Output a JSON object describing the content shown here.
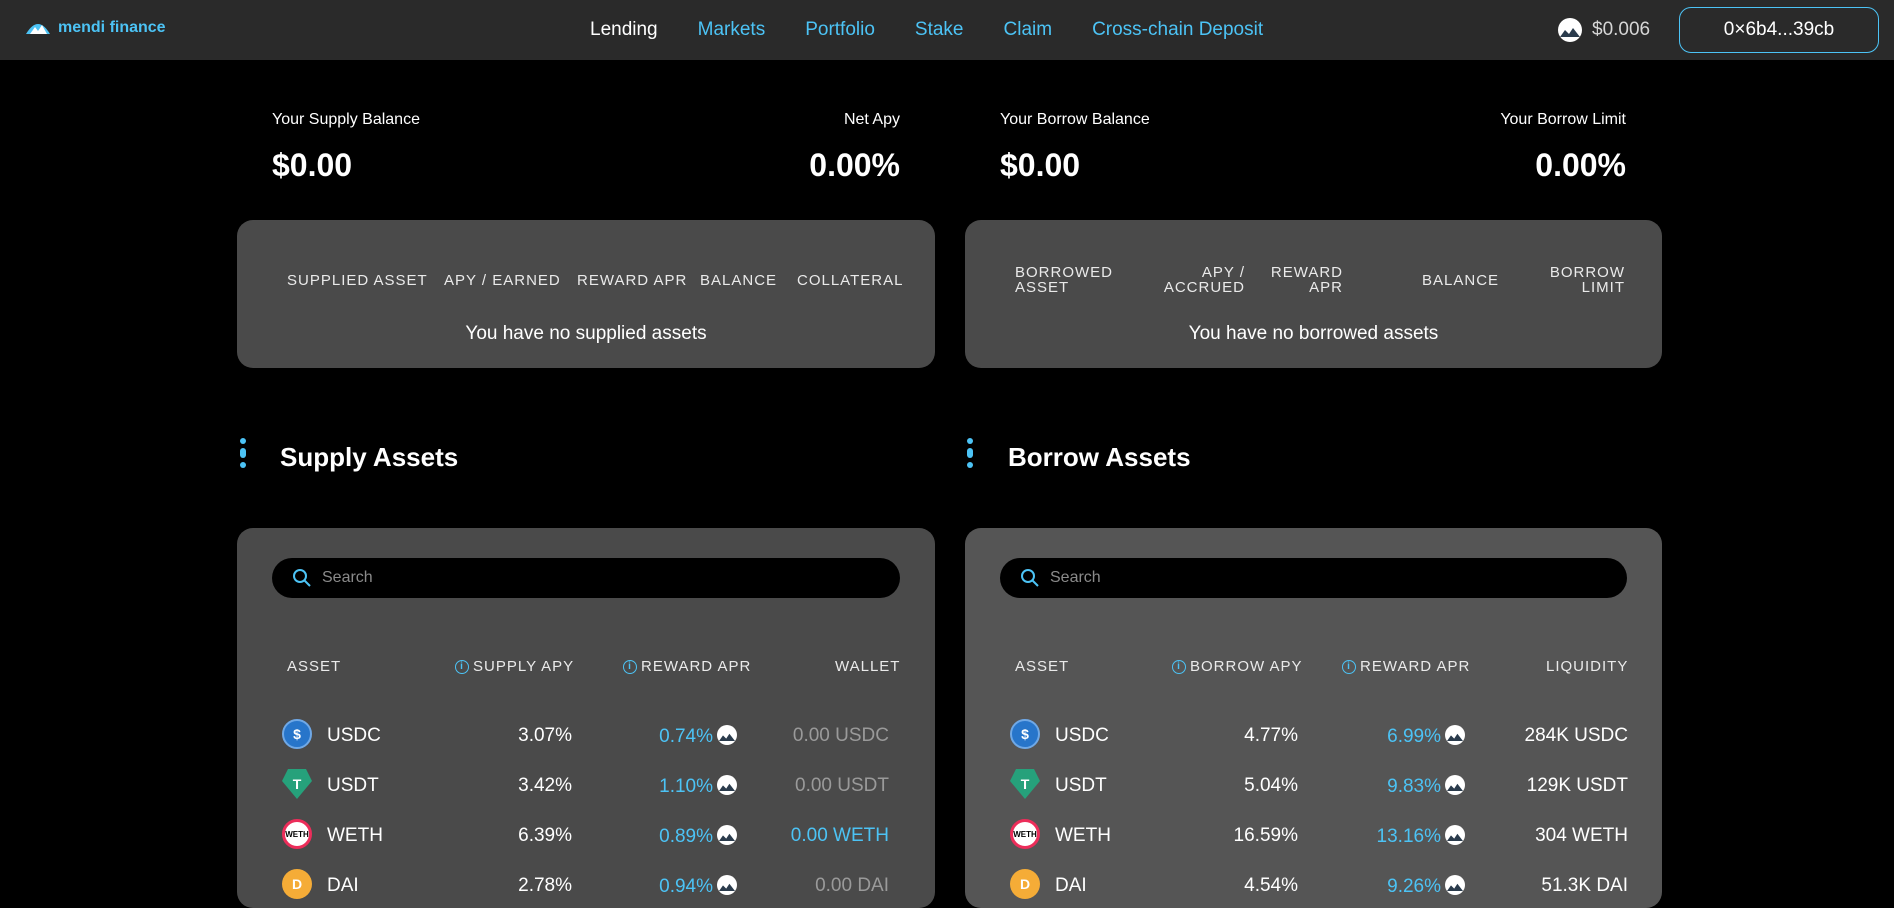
{
  "brand": {
    "name": "mendi finance"
  },
  "nav": [
    "Lending",
    "Markets",
    "Portfolio",
    "Stake",
    "Claim",
    "Cross-chain Deposit"
  ],
  "price": "$0.006",
  "wallet": "0×6b4...39cb",
  "summary": {
    "supply_balance_label": "Your Supply Balance",
    "supply_balance": "$0.00",
    "net_apy_label": "Net Apy",
    "net_apy": "0.00%",
    "borrow_balance_label": "Your Borrow Balance",
    "borrow_balance": "$0.00",
    "borrow_limit_label": "Your Borrow Limit",
    "borrow_limit": "0.00%"
  },
  "supplied": {
    "headers": [
      "SUPPLIED ASSET",
      "APY / EARNED",
      "REWARD APR",
      "BALANCE",
      "COLLATERAL"
    ],
    "empty": "You have no supplied assets"
  },
  "borrowed": {
    "headers": [
      "BORROWED ASSET",
      "APY / ACCRUED",
      "REWARD APR",
      "BALANCE",
      "BORROW LIMIT"
    ],
    "empty": "You have no borrowed assets"
  },
  "supply_assets": {
    "title": "Supply Assets",
    "search_placeholder": "Search",
    "headers": [
      "ASSET",
      "SUPPLY APY",
      "REWARD APR",
      "WALLET"
    ],
    "rows": [
      {
        "asset": "USDC",
        "apy": "3.07%",
        "reward": "0.74%",
        "wallet": "0.00 USDC",
        "wallet_color": "grey"
      },
      {
        "asset": "USDT",
        "apy": "3.42%",
        "reward": "1.10%",
        "wallet": "0.00 USDT",
        "wallet_color": "grey"
      },
      {
        "asset": "WETH",
        "apy": "6.39%",
        "reward": "0.89%",
        "wallet": "0.00 WETH",
        "wallet_color": "blue"
      },
      {
        "asset": "DAI",
        "apy": "2.78%",
        "reward": "0.94%",
        "wallet": "0.00 DAI",
        "wallet_color": "grey"
      }
    ]
  },
  "borrow_assets": {
    "title": "Borrow Assets",
    "search_placeholder": "Search",
    "headers": [
      "ASSET",
      "BORROW APY",
      "REWARD APR",
      "LIQUIDITY"
    ],
    "rows": [
      {
        "asset": "USDC",
        "apy": "4.77%",
        "reward": "6.99%",
        "liquidity": "284K USDC"
      },
      {
        "asset": "USDT",
        "apy": "5.04%",
        "reward": "9.83%",
        "liquidity": "129K USDT"
      },
      {
        "asset": "WETH",
        "apy": "16.59%",
        "reward": "13.16%",
        "liquidity": "304 WETH"
      },
      {
        "asset": "DAI",
        "apy": "4.54%",
        "reward": "9.26%",
        "liquidity": "51.3K DAI"
      }
    ]
  },
  "colors": {
    "accent": "#4cc3f5",
    "panel": "#4a4a4a",
    "topbar": "#2a2a2a"
  }
}
